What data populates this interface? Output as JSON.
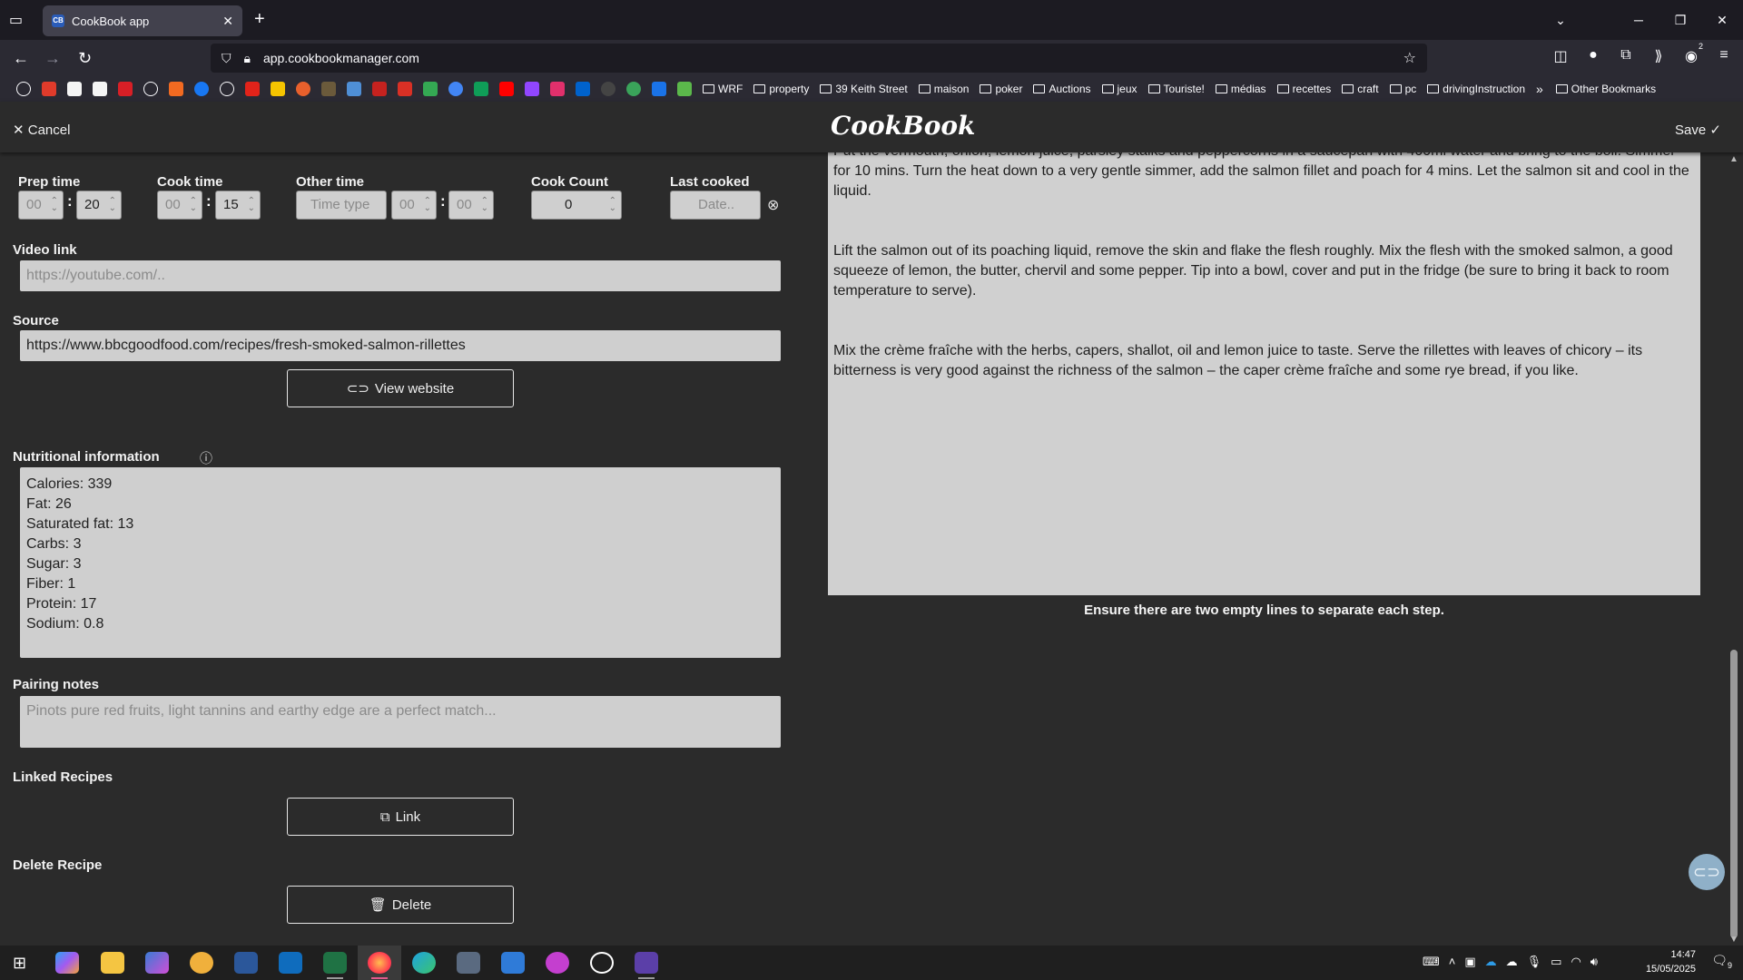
{
  "browser": {
    "tab_title": "CookBook app",
    "tab_favicon": "CB",
    "url_host": "app.cookbookmanager.com",
    "bookmarks_folders": [
      "WRF",
      "property",
      "39 Keith Street",
      "maison",
      "poker",
      "Auctions",
      "jeux",
      "Touriste!",
      "médias",
      "recettes",
      "craft",
      "pc",
      "drivingInstruction"
    ],
    "other_bookmarks": "Other Bookmarks",
    "ext_badge": "2"
  },
  "header": {
    "cancel": "Cancel",
    "logo": "CookBook",
    "save": "Save"
  },
  "times": {
    "prep_label": "Prep time",
    "prep_hours": "00",
    "prep_minutes": "20",
    "cook_label": "Cook time",
    "cook_hours": "00",
    "cook_minutes": "15",
    "other_label": "Other time",
    "other_type_placeholder": "Time type",
    "other_hours": "00",
    "other_minutes": "00",
    "cook_count_label": "Cook Count",
    "cook_count": "0",
    "last_cooked_label": "Last cooked",
    "last_cooked_placeholder": "Date.."
  },
  "video": {
    "label": "Video link",
    "placeholder": "https://youtube.com/.."
  },
  "source": {
    "label": "Source",
    "value": "https://www.bbcgoodfood.com/recipes/fresh-smoked-salmon-rillettes",
    "view_button": "View website"
  },
  "nutrition": {
    "label": "Nutritional information",
    "lines": [
      "Calories: 339",
      "Fat: 26",
      "Saturated fat: 13",
      "Carbs: 3",
      "Sugar: 3",
      "Fiber: 1",
      "Protein: 17",
      "Sodium: 0.8"
    ]
  },
  "pairing": {
    "label": "Pairing notes",
    "placeholder": "Pinots pure red fruits, light tannins and earthy edge are a perfect match..."
  },
  "linked": {
    "label": "Linked Recipes",
    "button": "Link"
  },
  "delete": {
    "label": "Delete Recipe",
    "button": "Delete"
  },
  "instructions": {
    "steps": [
      "Put the vermouth, onion, lemon juice, parsley stalks and peppercorns in a saucepan with 400ml water and bring to the boil. Simmer for 10 mins. Turn the heat down to a very gentle simmer, add the salmon fillet and poach for 4 mins. Let the salmon sit and cool in the liquid.",
      "Lift the salmon out of its poaching liquid, remove the skin and flake the flesh roughly. Mix the flesh with the smoked salmon, a good squeeze of lemon, the butter, chervil and some pepper. Tip into a bowl, cover and put in the fridge (be sure to bring it back to room temperature to serve).",
      "Mix the crème fraîche with the herbs, capers, shallot, oil and lemon juice to taste. Serve the rillettes with leaves of chicory – its bitterness is very good against the richness of the salmon – the caper crème fraîche and some rye bread, if you like."
    ],
    "hint": "Ensure there are two empty lines to separate each step."
  },
  "taskbar": {
    "time": "14:47",
    "date": "15/05/2025",
    "notif_count": "9"
  }
}
